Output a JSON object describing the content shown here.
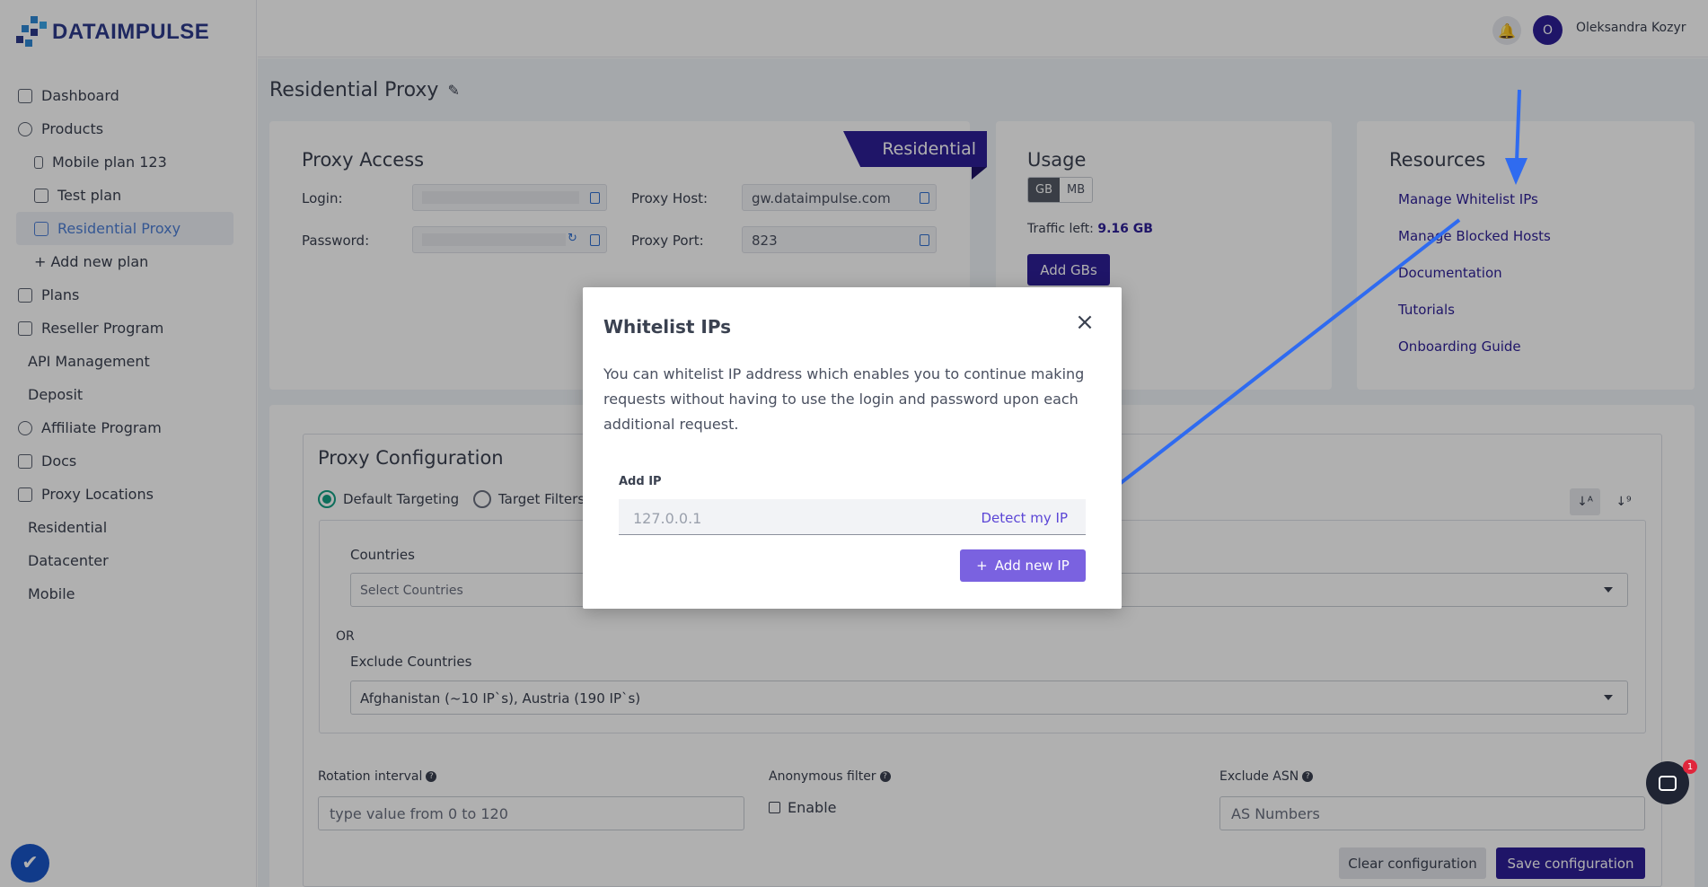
{
  "brand": {
    "name": "DATAIMPULSE"
  },
  "sidebar": {
    "items": [
      {
        "label": "Dashboard"
      },
      {
        "label": "Products"
      },
      {
        "label": "Mobile plan 123"
      },
      {
        "label": "Test plan"
      },
      {
        "label": "Residential Proxy"
      },
      {
        "label": "+ Add new plan"
      },
      {
        "label": "Plans"
      },
      {
        "label": "Reseller Program"
      },
      {
        "label": "API Management"
      },
      {
        "label": "Deposit"
      },
      {
        "label": "Affiliate Program"
      },
      {
        "label": "Docs"
      },
      {
        "label": "Proxy Locations"
      },
      {
        "label": "Residential"
      },
      {
        "label": "Datacenter"
      },
      {
        "label": "Mobile"
      }
    ]
  },
  "header": {
    "avatar_initial": "O",
    "user_name": "Oleksandra Kozyr"
  },
  "page": {
    "title": "Residential Proxy"
  },
  "proxy_access": {
    "title": "Proxy Access",
    "badge": "Residential",
    "login_label": "Login:",
    "password_label": "Password:",
    "host_label": "Proxy Host:",
    "host_value": "gw.dataimpulse.com",
    "port_label": "Proxy Port:",
    "port_value": "823"
  },
  "usage": {
    "title": "Usage",
    "unit_gb": "GB",
    "unit_mb": "MB",
    "traffic_label": "Traffic left:",
    "traffic_value": "9.16 GB",
    "add_button": "Add GBs"
  },
  "resources": {
    "title": "Resources",
    "links": [
      {
        "label": "Manage Whitelist IPs"
      },
      {
        "label": "Manage Blocked Hosts"
      },
      {
        "label": "Documentation"
      },
      {
        "label": "Tutorials"
      },
      {
        "label": "Onboarding Guide"
      }
    ]
  },
  "config": {
    "title": "Proxy Configuration",
    "default_targeting": "Default Targeting",
    "target_filters": "Target Filters",
    "countries_label": "Countries",
    "countries_placeholder": "Select Countries",
    "or_label": "OR",
    "exclude_label": "Exclude Countries",
    "exclude_value": "Afghanistan (~10 IP`s), Austria (190 IP`s)",
    "rotation_label": "Rotation interval",
    "rotation_placeholder": "type value from 0 to 120",
    "anon_label": "Anonymous filter",
    "anon_checkbox": "Enable",
    "asn_label": "Exclude ASN",
    "asn_placeholder": "AS Numbers",
    "clear_button": "Clear configuration",
    "save_button": "Save configuration"
  },
  "modal": {
    "title": "Whitelist IPs",
    "close": "×",
    "description": "You can whitelist IP address which enables you to continue making requests without having to use the login and password upon each additional request.",
    "add_ip_label": "Add IP",
    "ip_placeholder": "127.0.0.1",
    "detect_link": "Detect my IP",
    "add_button": "Add new IP"
  },
  "chat": {
    "badge": "1"
  },
  "colors": {
    "brand": "#2e1f97",
    "accent": "#7a62e0",
    "arrow": "#2f6bf0"
  }
}
